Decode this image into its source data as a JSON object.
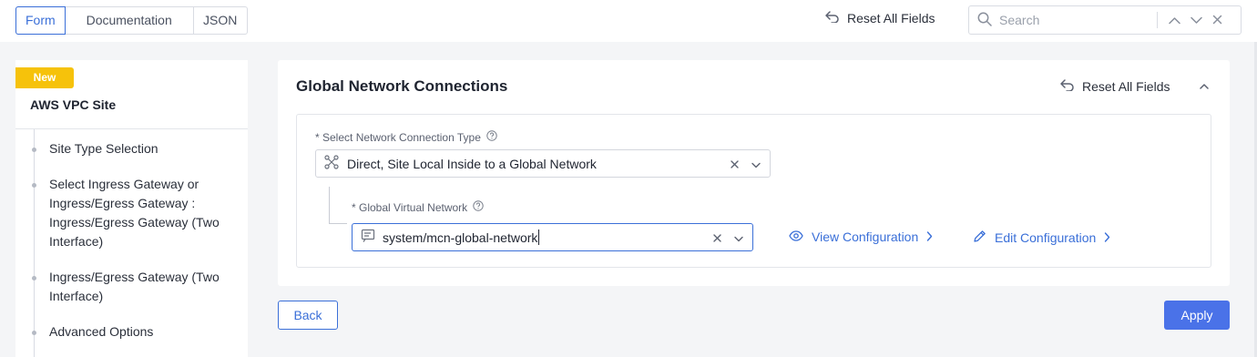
{
  "topbar": {
    "tabs": [
      {
        "label": "Form",
        "active": true
      },
      {
        "label": "Documentation",
        "active": false
      },
      {
        "label": "JSON",
        "active": false
      }
    ],
    "reset_label": "Reset All Fields",
    "search": {
      "placeholder": "Search",
      "value": ""
    }
  },
  "sidebar": {
    "badge": "New",
    "title": "AWS VPC Site",
    "steps": [
      {
        "label": "Site Type Selection"
      },
      {
        "label": "Select Ingress Gateway or Ingress/Egress Gateway : Ingress/Egress Gateway (Two Interface)"
      },
      {
        "label": "Ingress/Egress Gateway (Two Interface)"
      },
      {
        "label": "Advanced Options"
      }
    ]
  },
  "card": {
    "title": "Global Network Connections",
    "reset_label": "Reset All Fields",
    "connection_type": {
      "label": "* Select Network Connection Type",
      "value": "Direct, Site Local Inside to a Global Network"
    },
    "global_vn": {
      "label": "* Global Virtual Network",
      "value": "system/mcn-global-network"
    },
    "view_config_label": "View Configuration",
    "edit_config_label": "Edit Configuration"
  },
  "footer": {
    "back_label": "Back",
    "apply_label": "Apply"
  },
  "colors": {
    "accent": "#3a6fd8",
    "apply": "#4a72e8",
    "badge": "#f6c20b"
  }
}
